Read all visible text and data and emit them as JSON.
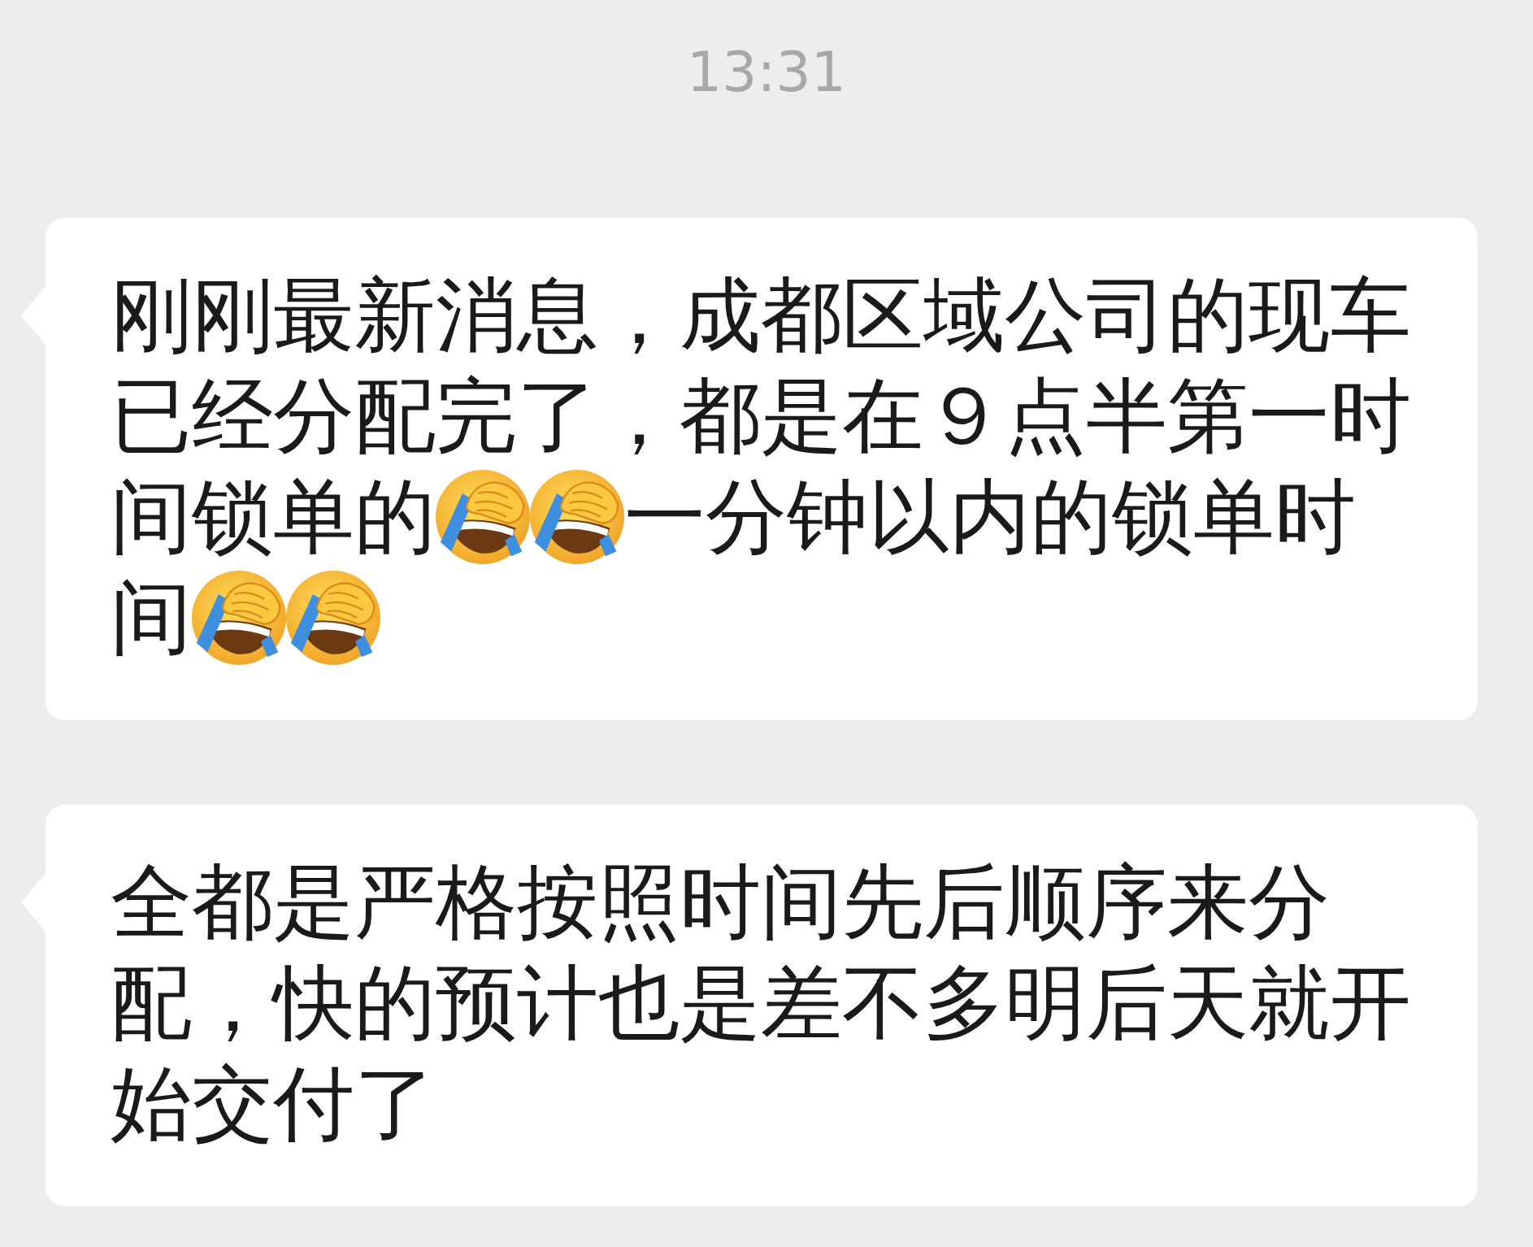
{
  "time": "13:31",
  "messages": [
    {
      "lines": [
        [
          {
            "kind": "text",
            "text": "刚刚最新消息，成都区域公司的现车"
          }
        ],
        [
          {
            "kind": "text",
            "text": "已经分配完了，都是在９点半第一时"
          }
        ],
        [
          {
            "kind": "text",
            "text": "间锁单的"
          },
          {
            "kind": "emoji"
          },
          {
            "kind": "emoji"
          },
          {
            "kind": "text",
            "text": "一分钟以内的锁单时"
          }
        ],
        [
          {
            "kind": "text",
            "text": "间"
          },
          {
            "kind": "emoji"
          },
          {
            "kind": "emoji"
          }
        ]
      ]
    },
    {
      "lines": [
        [
          {
            "kind": "text",
            "text": "全都是严格按照时间先后顺序来分配，快的预计也是差不多明后天就开始交付了"
          }
        ]
      ]
    }
  ]
}
